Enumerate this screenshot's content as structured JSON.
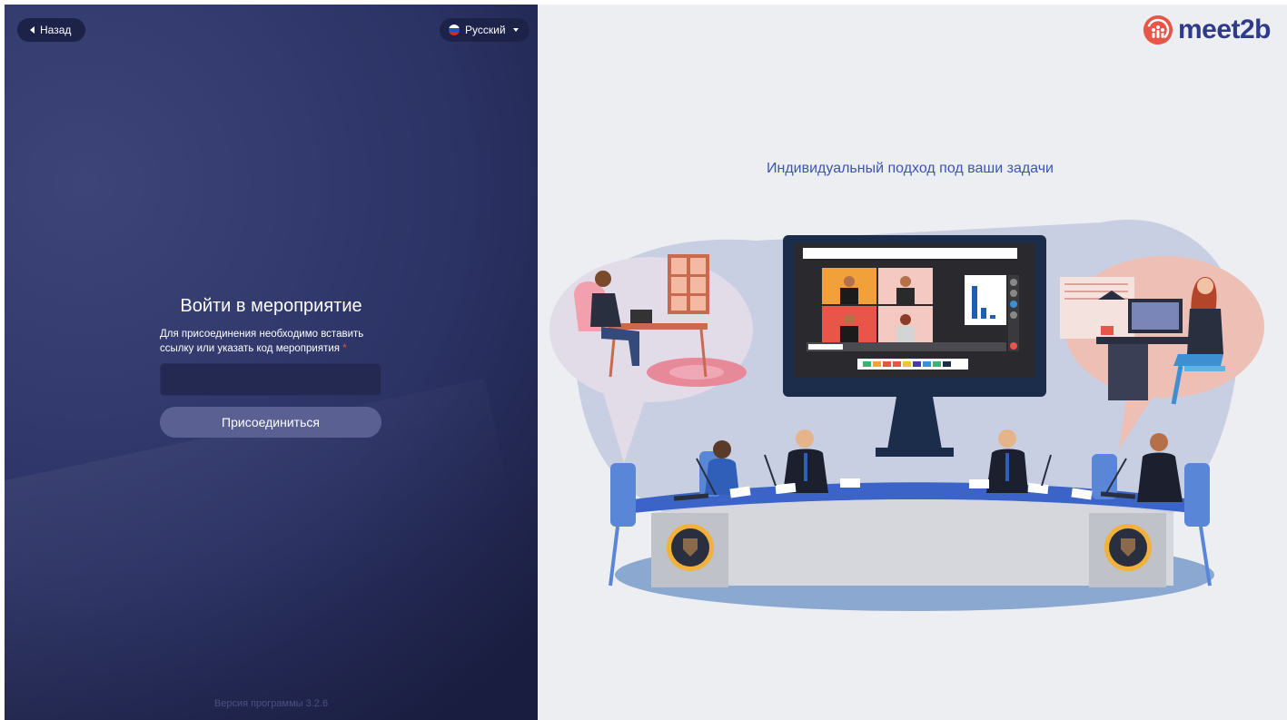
{
  "header": {
    "back_label": "Назад",
    "language_label": "Русский"
  },
  "login": {
    "title": "Войти в мероприятие",
    "hint": "Для присоединения необходимо вставить ссылку или указать код мероприятия",
    "required_mark": "*",
    "code_value": "",
    "join_label": "Присоединиться"
  },
  "footer": {
    "version": "Версия программы 3.2.6"
  },
  "promo": {
    "logo_text": "meet2b",
    "tagline": "Индивидуальный подход под ваши задачи"
  },
  "colors": {
    "left_panel": "#2f376b",
    "accent": "#3e54b4",
    "logo_red": "#e8564a",
    "button": "#5a6192"
  },
  "icons": {
    "back": "caret-left-icon",
    "language": "russian-flag-icon",
    "dropdown": "chevron-down-icon",
    "logo": "meet2b-logo-icon"
  }
}
